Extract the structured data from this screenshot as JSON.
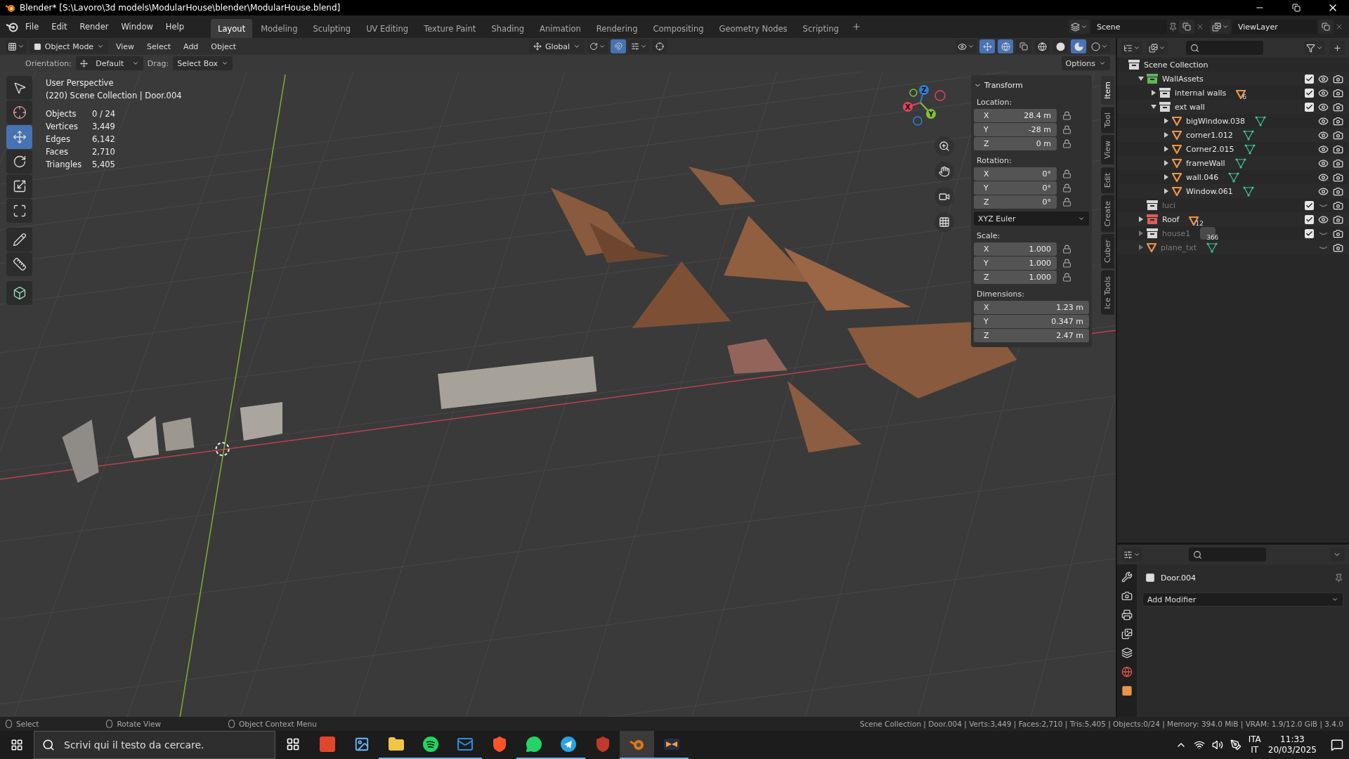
{
  "window": {
    "title": "Blender* [S:\\Lavoro\\3d models\\ModularHouse\\blender\\ModularHouse.blend]"
  },
  "menu": [
    "File",
    "Edit",
    "Render",
    "Window",
    "Help"
  ],
  "workspaces": [
    {
      "label": "Layout",
      "selected": true
    },
    {
      "label": "Modeling",
      "selected": false
    },
    {
      "label": "Sculpting",
      "selected": false
    },
    {
      "label": "UV Editing",
      "selected": false
    },
    {
      "label": "Texture Paint",
      "selected": false
    },
    {
      "label": "Shading",
      "selected": false
    },
    {
      "label": "Animation",
      "selected": false
    },
    {
      "label": "Rendering",
      "selected": false
    },
    {
      "label": "Compositing",
      "selected": false
    },
    {
      "label": "Geometry Nodes",
      "selected": false
    },
    {
      "label": "Scripting",
      "selected": false
    }
  ],
  "scene": {
    "scene": "Scene",
    "view_layer": "ViewLayer"
  },
  "viewport_header": {
    "mode": "Object Mode",
    "menus": [
      "View",
      "Select",
      "Add",
      "Object"
    ],
    "orientation": "Global"
  },
  "tool_settings": {
    "orientation_label": "Orientation:",
    "orientation": "Default",
    "drag_label": "Drag:",
    "drag": "Select Box",
    "options": "Options"
  },
  "tools": [
    {
      "kind": "select",
      "selected": false
    },
    {
      "kind": "cursor",
      "selected": false
    },
    {
      "kind": "move",
      "selected": true
    },
    {
      "kind": "rotate",
      "selected": false
    },
    {
      "kind": "scale",
      "selected": false
    },
    {
      "kind": "transform",
      "selected": false
    },
    {
      "kind": "annotate",
      "selected": false
    },
    {
      "kind": "measure",
      "selected": false
    },
    {
      "kind": "add-cube",
      "selected": false
    }
  ],
  "overlay": {
    "view": "User Perspective",
    "context": "(220) Scene Collection | Door.004",
    "stats": [
      {
        "label": "Objects",
        "value": "0 / 24"
      },
      {
        "label": "Vertices",
        "value": "3,449"
      },
      {
        "label": "Edges",
        "value": "6,142"
      },
      {
        "label": "Faces",
        "value": "2,710"
      },
      {
        "label": "Triangles",
        "value": "5,405"
      }
    ]
  },
  "gizmo": [
    {
      "label": "Z",
      "color": "#2f7fd6"
    },
    {
      "label": "Y",
      "color": "#7fc23a"
    },
    {
      "label": "X",
      "color": "#e0435a"
    }
  ],
  "n_panel": {
    "title": "Transform",
    "sections": [
      {
        "label": "Location:",
        "lockable": true,
        "fields": [
          {
            "axis": "X",
            "value": "28.4 m"
          },
          {
            "axis": "Y",
            "value": "-28 m"
          },
          {
            "axis": "Z",
            "value": "0 m"
          }
        ]
      },
      {
        "label": "Rotation:",
        "lockable": true,
        "fields": [
          {
            "axis": "X",
            "value": "0°"
          },
          {
            "axis": "Y",
            "value": "0°"
          },
          {
            "axis": "Z",
            "value": "0°"
          }
        ],
        "mode": "XYZ Euler"
      },
      {
        "label": "Scale:",
        "lockable": true,
        "fields": [
          {
            "axis": "X",
            "value": "1.000"
          },
          {
            "axis": "Y",
            "value": "1.000"
          },
          {
            "axis": "Z",
            "value": "1.000"
          }
        ]
      },
      {
        "label": "Dimensions:",
        "lockable": false,
        "fields": [
          {
            "axis": "X",
            "value": "1.23 m"
          },
          {
            "axis": "Y",
            "value": "0.347 m"
          },
          {
            "axis": "Z",
            "value": "2.47 m"
          }
        ]
      }
    ],
    "tabs": [
      {
        "label": "Item",
        "selected": true
      },
      {
        "label": "Tool",
        "selected": false
      },
      {
        "label": "View",
        "selected": false
      },
      {
        "label": "Edit",
        "selected": false
      },
      {
        "label": "Create",
        "selected": false
      },
      {
        "label": "Cuber",
        "selected": false
      },
      {
        "label": "Ice Tools",
        "selected": false
      }
    ]
  },
  "outliner": {
    "root": "Scene Collection",
    "items": [
      {
        "name": "WallAssets",
        "kind": "collection",
        "color": "#63b35e",
        "expanded": true,
        "checked": true,
        "visible": true,
        "children": [
          {
            "name": "internal walls",
            "kind": "collection",
            "color": "#d8d8d8",
            "expanded": false,
            "checked": true,
            "visible": true,
            "badge": {
              "kind": "mesh",
              "count": "6"
            }
          },
          {
            "name": "ext wall",
            "kind": "collection",
            "color": "#d8d8d8",
            "expanded": true,
            "checked": true,
            "visible": true,
            "children": [
              {
                "name": "bigWindow.038",
                "kind": "object",
                "expanded": false,
                "visible": true
              },
              {
                "name": "corner1.012",
                "kind": "object",
                "expanded": false,
                "visible": true
              },
              {
                "name": "Corner2.015",
                "kind": "object",
                "expanded": false,
                "visible": true
              },
              {
                "name": "frameWall",
                "kind": "object",
                "expanded": false,
                "visible": true
              },
              {
                "name": "wall.046",
                "kind": "object",
                "expanded": false,
                "visible": true
              },
              {
                "name": "Window.061",
                "kind": "object",
                "expanded": false,
                "visible": true
              }
            ]
          }
        ]
      },
      {
        "name": "luci",
        "kind": "collection",
        "color": "#d8d8d8",
        "checked": true,
        "visible": false
      },
      {
        "name": "Roof",
        "kind": "collection",
        "color": "#e05a5a",
        "expanded": false,
        "checked": true,
        "visible": true,
        "badge": {
          "kind": "mesh",
          "count": "12"
        }
      },
      {
        "name": "house1",
        "kind": "collection",
        "color": "#d8d8d8",
        "expanded": false,
        "checked": true,
        "visible": false,
        "badge": {
          "kind": "mixed",
          "count": "366"
        }
      },
      {
        "name": "plane_txt",
        "kind": "object",
        "expanded": false,
        "visible": false
      }
    ]
  },
  "properties": {
    "object": "Door.004",
    "add_modifier": "Add Modifier"
  },
  "status_bar": {
    "hints": [
      "Select",
      "Rotate View",
      "Object Context Menu"
    ],
    "info": "Scene Collection | Door.004 | Verts:3,449 | Faces:2,710 | Tris:5,405 | Objects:0/24 | Memory: 394.0 MiB | VRAM: 1.9/12.0 GiB | 3.4.0"
  },
  "taskbar": {
    "search_placeholder": "Scrivi qui il testo da cercare.",
    "apps": [
      {
        "kind": "tasks",
        "running": false,
        "active": false
      },
      {
        "kind": "tile",
        "running": false,
        "active": false
      },
      {
        "kind": "photos",
        "running": false,
        "active": false
      },
      {
        "kind": "folder",
        "running": true,
        "active": false
      },
      {
        "kind": "music",
        "running": true,
        "active": false
      },
      {
        "kind": "mail",
        "running": true,
        "active": false
      },
      {
        "kind": "shield",
        "running": false,
        "active": false
      },
      {
        "kind": "chat",
        "running": true,
        "active": false
      },
      {
        "kind": "plane",
        "running": true,
        "active": false
      },
      {
        "kind": "shield-x",
        "running": false,
        "active": false
      },
      {
        "kind": "orbit",
        "running": true,
        "active": true
      },
      {
        "kind": "bowtie",
        "running": true,
        "active": false
      }
    ],
    "language": "ITA",
    "region": "IT",
    "time": "11:33",
    "date": "20/03/2025"
  }
}
